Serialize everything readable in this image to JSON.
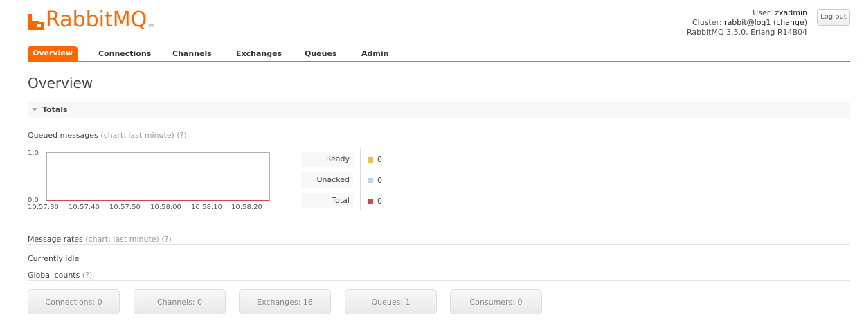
{
  "app": {
    "logo_text": "RabbitMQ",
    "logo_tm": "TM",
    "brand_color": "#ff6600"
  },
  "login": {
    "user_label": "User:",
    "user": "zxadmin",
    "cluster_label": "Cluster:",
    "cluster": "rabbit@log1",
    "change_label": "change",
    "version": "RabbitMQ 3.5.0,",
    "erlang": "Erlang R14B04",
    "logout_label": "Log out"
  },
  "nav": {
    "tabs": [
      {
        "label": "Overview",
        "active": true
      },
      {
        "label": "Connections"
      },
      {
        "label": "Channels"
      },
      {
        "label": "Exchanges"
      },
      {
        "label": "Queues"
      },
      {
        "label": "Admin"
      }
    ]
  },
  "page": {
    "title": "Overview",
    "section_title": "Totals"
  },
  "queued": {
    "label": "Queued messages",
    "hint": "(chart: last minute)",
    "help": "(?)"
  },
  "chart_data": {
    "type": "line",
    "x": [
      "10:57:30",
      "10:57:40",
      "10:57:50",
      "10:58:00",
      "10:58:10",
      "10:58:20"
    ],
    "y_ticks": [
      "1.0",
      "0.0"
    ],
    "ylim": [
      0,
      1
    ],
    "series": [
      {
        "name": "Ready",
        "color": "#edc240",
        "values": [
          0,
          0,
          0,
          0,
          0,
          0
        ]
      },
      {
        "name": "Unacked",
        "color": "#afd8f8",
        "values": [
          0,
          0,
          0,
          0,
          0,
          0
        ]
      },
      {
        "name": "Total",
        "color": "#cb4b4b",
        "values": [
          0,
          0,
          0,
          0,
          0,
          0
        ]
      }
    ]
  },
  "legend": {
    "ready_label": "Ready",
    "ready_value": "0",
    "unacked_label": "Unacked",
    "unacked_value": "0",
    "total_label": "Total",
    "total_value": "0"
  },
  "rates": {
    "label": "Message rates",
    "hint": "(chart: last minute)",
    "help": "(?)",
    "idle": "Currently idle"
  },
  "global": {
    "label": "Global counts",
    "help": "(?)",
    "connections": "Connections: 0",
    "channels": "Channels: 0",
    "exchanges": "Exchanges: 16",
    "queues": "Queues: 1",
    "consumers": "Consumers: 0"
  }
}
